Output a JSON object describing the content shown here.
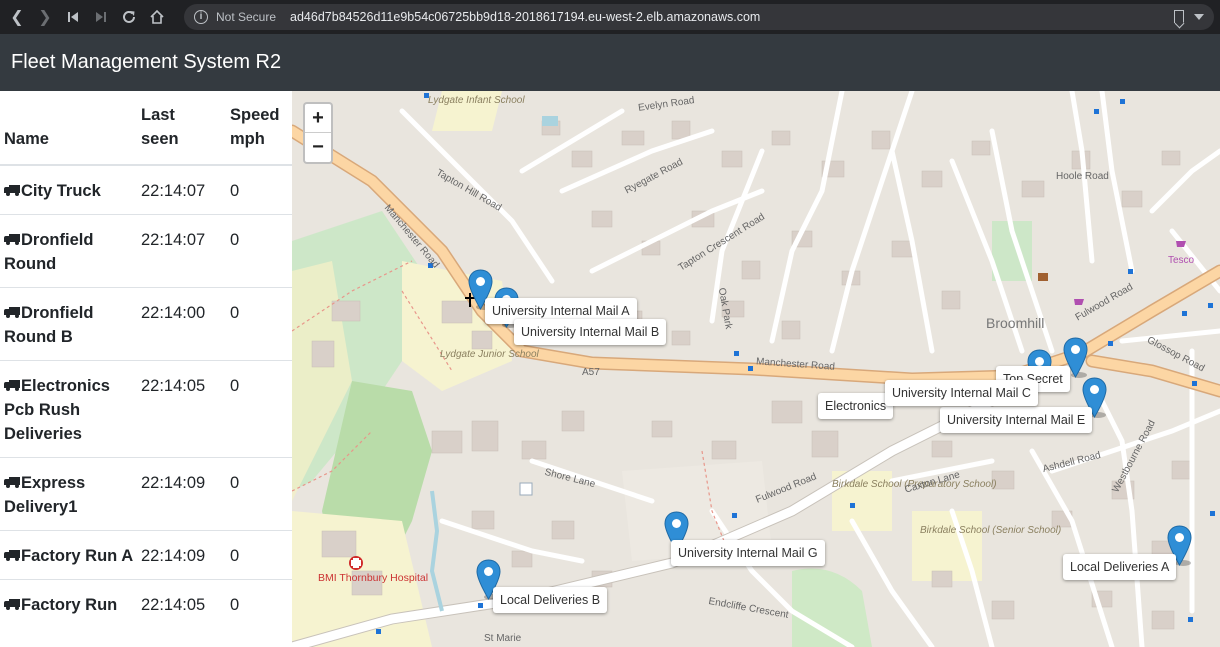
{
  "browser": {
    "security_label": "Not Secure",
    "url": "ad46d7b84526d11e9b54c06725bb9d18-2018617194.eu-west-2.elb.amazonaws.com"
  },
  "app": {
    "title": "Fleet Management System R2"
  },
  "table": {
    "headers": {
      "name": "Name",
      "last_seen_1": "Last",
      "last_seen_2": "seen",
      "speed_1": "Speed",
      "speed_2": "mph"
    },
    "rows": [
      {
        "name": "City Truck",
        "last_seen": "22:14:07",
        "speed": "0"
      },
      {
        "name": "Dronfield Round",
        "last_seen": "22:14:07",
        "speed": "0"
      },
      {
        "name": "Dronfield Round B",
        "last_seen": "22:14:00",
        "speed": "0"
      },
      {
        "name": "Electronics Pcb Rush Deliveries",
        "last_seen": "22:14:05",
        "speed": "0"
      },
      {
        "name": "Express Delivery1",
        "last_seen": "22:14:09",
        "speed": "0"
      },
      {
        "name": "Factory Run A",
        "last_seen": "22:14:09",
        "speed": "0"
      },
      {
        "name": "Factory Run",
        "last_seen": "22:14:05",
        "speed": "0"
      }
    ]
  },
  "map": {
    "zoom_in": "+",
    "zoom_out": "−",
    "labels": {
      "uni_mail_a": "University Internal Mail A",
      "uni_mail_b": "University Internal Mail B",
      "top_secret": "Top Secret",
      "uni_mail_c": "University Internal Mail C",
      "electronics": "Electronics",
      "uni_mail_e": "University Internal Mail E",
      "uni_mail_g": "University Internal Mail G",
      "local_a": "Local Deliveries A",
      "local_b": "Local Deliveries B"
    },
    "places": {
      "broomhill": "Broomhill",
      "manchester_road": "Manchester Road",
      "manchester_road_2": "Manchester Road",
      "a57": "A57",
      "fulwood_road": "Fulwood Road",
      "fulwood_road_2": "Fulwood Road",
      "glossop_road": "Glossop Road",
      "lydgate_infant": "Lydgate Infant School",
      "lydgate_junior": "Lydgate Junior School",
      "birkdale_prep": "Birkdale School (Preparatory School)",
      "birkdale_senior": "Birkdale School (Senior School)",
      "bmi_hospital": "BMI Thornbury Hospital",
      "tesco": "Tesco",
      "shore_lane": "Shore Lane",
      "ashdell_road": "Ashdell Road",
      "caxton_lane": "Caxton Lane",
      "evelyn_road": "Evelyn Road",
      "hoole_road": "Hoole Road",
      "endcliffe_crescent": "Endcliffe Crescent",
      "st_marie": "St Marie",
      "ryegate_road": "Ryegate Road",
      "tapton_hill_road": "Tapton Hill Road",
      "tapton_crescent_road": "Tapton Crescent Road",
      "oak_park": "Oak Park",
      "westbourne_road": "Westbourne Road"
    }
  }
}
